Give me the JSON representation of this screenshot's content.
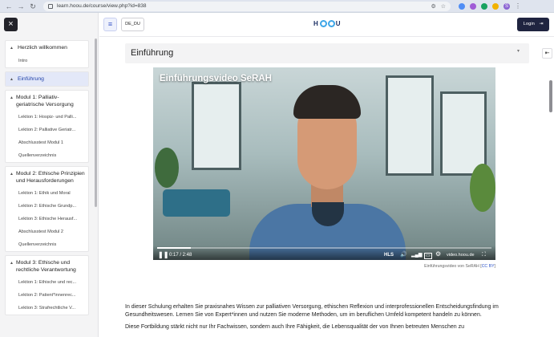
{
  "browser": {
    "url": "learn.hoou.de/course/view.php?id=838",
    "profile_initial": "S",
    "extension_colors": [
      "#4f8df5",
      "#a05bd6",
      "#1aa260",
      "#f2b200"
    ]
  },
  "sidebar": {
    "close_label": "×",
    "sections": [
      {
        "title": "Herzlich willkommen",
        "active": false,
        "items": [
          "Intro"
        ]
      },
      {
        "title": "Einführung",
        "active": true,
        "items": []
      },
      {
        "title": "Modul 1: Palliativ-geriatrische Versorgung",
        "active": false,
        "items": [
          "Lektion 1: Hospiz- und Palli...",
          "Lektion 2: Palliative Geriatr...",
          "Abschlusstest Modul 1",
          "Quellenverzeichnis"
        ]
      },
      {
        "title": "Modul 2: Ethische Prinzipien und Herausforderungen",
        "active": false,
        "items": [
          "Lektion 1: Ethik und Moral",
          "Lektion 2: Ethische Grundp...",
          "Lektion 3: Ethische Herausf...",
          "Abschlusstest Modul 2",
          "Quellenverzeichnis"
        ]
      },
      {
        "title": "Modul 3: Ethische und rechtliche Verantwortung",
        "active": false,
        "items": [
          "Lektion 1: Ethische und rec...",
          "Lektion 2: Patient*innenrec...",
          "Lektion 3: Strafrechtliche V..."
        ]
      }
    ]
  },
  "topbar": {
    "menu_label": "≡",
    "language": "DE_DU",
    "logo_text": [
      "H",
      "O",
      "O",
      "U"
    ],
    "login_label": "Login"
  },
  "section": {
    "title": "Einführung"
  },
  "video": {
    "title": "Einführungsvideo SeRAH",
    "time": "0:17 / 2:48",
    "progress": 0.1,
    "quality": "HLS",
    "brand": "video.hoou.de",
    "caption_prefix": "Einführungsvideo von SeRAH",
    "caption_license": "CC BY"
  },
  "body": {
    "paragraphs": [
      "In dieser Schulung erhalten Sie praxisnahes Wissen zur palliativen Versorgung, ethischen Reflexion und interprofessionellen Entscheidungsfindung im Gesundheitswesen. Lernen Sie von Expert*innen und nutzen Sie moderne Methoden, um im beruflichen Umfeld kompetent handeln zu können.",
      "Diese Fortbildung stärkt nicht nur Ihr Fachwissen, sondern auch Ihre Fähigkeit, die Lebensqualität der von Ihnen betreuten Menschen zu"
    ]
  }
}
